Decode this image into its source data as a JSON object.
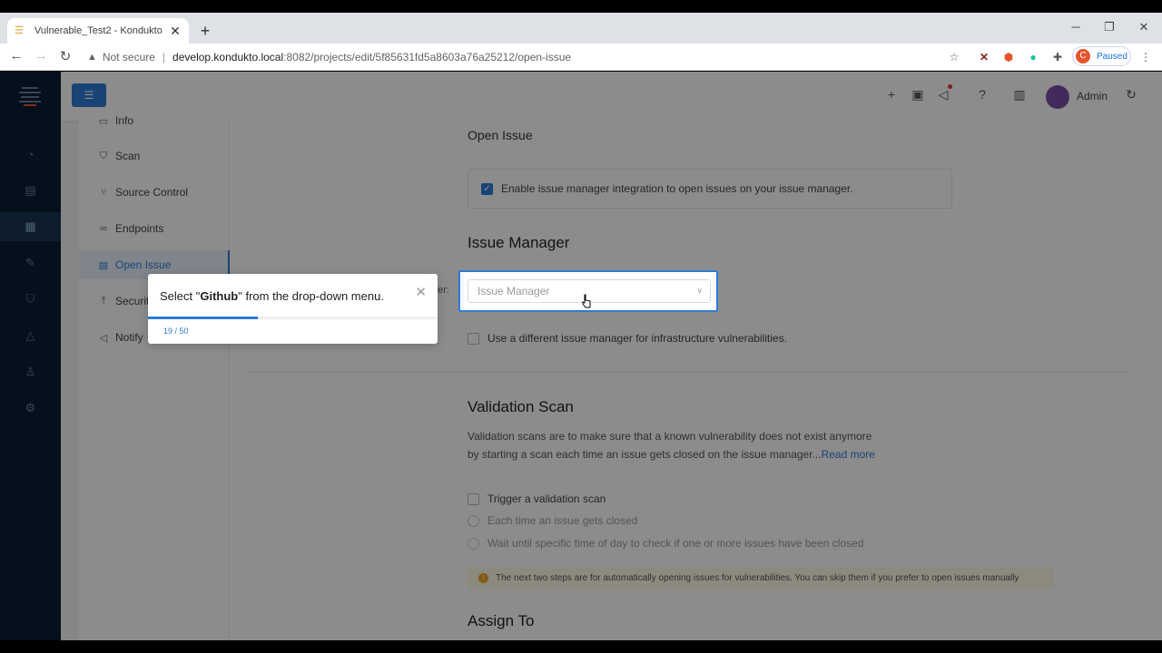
{
  "browser": {
    "tab_title": "Vulnerable_Test2 - Kondukto",
    "tab_close": "✕",
    "new_tab": "+",
    "security_label": "Not secure",
    "url_host": "develop.kondukto.local",
    "url_path": ":8082/projects/edit/5f85631fd5a8603a76a25212/open-issue",
    "profile_initial": "C",
    "profile_status": "Paused"
  },
  "header": {
    "user_name": "Admin"
  },
  "subnav": {
    "items": [
      {
        "label": "Info"
      },
      {
        "label": "Scan"
      },
      {
        "label": "Source Control"
      },
      {
        "label": "Endpoints"
      },
      {
        "label": "Open Issue"
      },
      {
        "label": "Securit"
      },
      {
        "label": "Notify"
      }
    ]
  },
  "content": {
    "open_issue_title": "Open Issue",
    "enable_label": "Enable issue manager integration to open issues on your issue manager.",
    "issue_manager_title": "Issue Manager",
    "issue_manager_field_label_fragment": "er:",
    "issue_manager_placeholder": "Issue Manager",
    "different_manager_label": "Use a different issue manager for infrastructure vulnerabilities.",
    "validation_title": "Validation Scan",
    "validation_desc": "Validation scans are to make sure that a known vulnerability does not exist anymore by starting a scan each time an issue gets closed on the issue manager...",
    "read_more": "Read more",
    "trigger_label": "Trigger a validation scan",
    "radio_each": "Each time an issue gets closed",
    "radio_wait": "Wait until specific time of day to check if one or more issues have been closed",
    "warning_text": "The next two steps are for automatically opening issues for vulnerabilities. You can skip them if you prefer to open issues manually",
    "assign_title": "Assign To"
  },
  "tour": {
    "message_pre": "Select \"",
    "message_bold": "Github",
    "message_post": "\" from the drop-down menu.",
    "step_text": "19 / 50",
    "step_current": 19,
    "step_total": 50,
    "close": "✕"
  },
  "colors": {
    "accent": "#2e7bd6",
    "sidebar": "#0a1e33"
  }
}
